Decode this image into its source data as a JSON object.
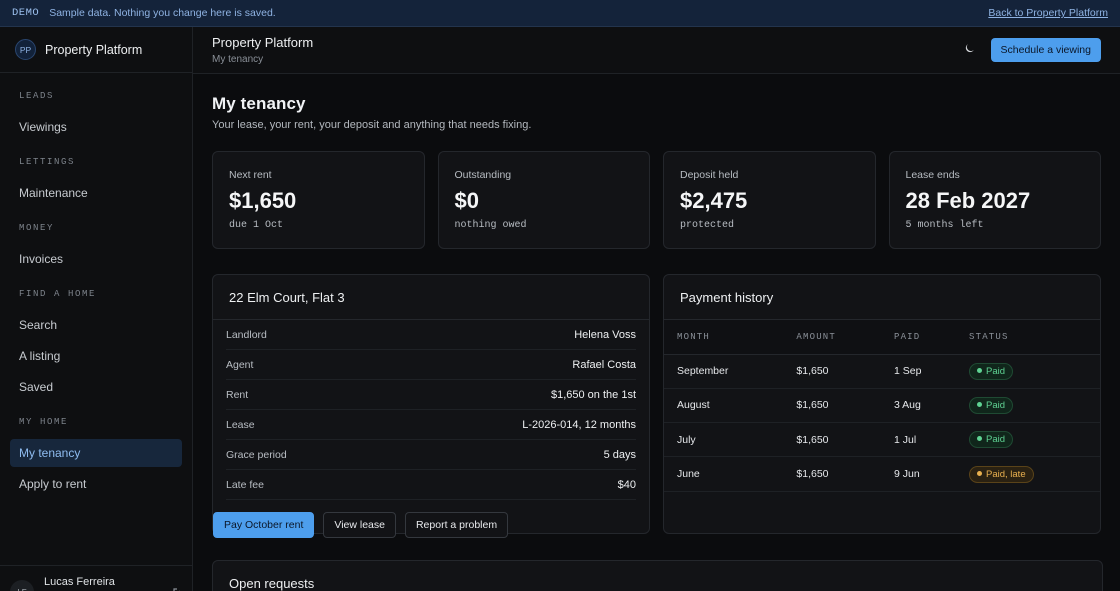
{
  "banner": {
    "tag": "DEMO",
    "text": "Sample data. Nothing you change here is saved.",
    "back_link": "Back to Property Platform"
  },
  "sidebar": {
    "logo_initials": "PP",
    "brand": "Property Platform",
    "sections": [
      {
        "title": "LEADS",
        "items": [
          "Viewings"
        ]
      },
      {
        "title": "LETTINGS",
        "items": [
          "Maintenance"
        ]
      },
      {
        "title": "MONEY",
        "items": [
          "Invoices"
        ]
      },
      {
        "title": "FIND A HOME",
        "items": [
          "Search",
          "A listing",
          "Saved"
        ]
      },
      {
        "title": "MY HOME",
        "items": [
          "My tenancy",
          "Apply to rent"
        ]
      }
    ],
    "active_item": "My tenancy",
    "user": {
      "initials": "LF",
      "name": "Lucas Ferreira"
    }
  },
  "header": {
    "title": "Property Platform",
    "subtitle": "My tenancy",
    "cta": "Schedule a viewing"
  },
  "page": {
    "title": "My tenancy",
    "subtitle": "Your lease, your rent, your deposit and anything that needs fixing."
  },
  "stats": [
    {
      "label": "Next rent",
      "value": "$1,650",
      "note": "due 1 Oct"
    },
    {
      "label": "Outstanding",
      "value": "$0",
      "note": "nothing owed"
    },
    {
      "label": "Deposit held",
      "value": "$2,475",
      "note": "protected"
    },
    {
      "label": "Lease ends",
      "value": "28 Feb 2027",
      "note": "5 months left"
    }
  ],
  "property": {
    "title": "22 Elm Court, Flat 3",
    "details": [
      {
        "k": "Landlord",
        "v": "Helena Voss"
      },
      {
        "k": "Agent",
        "v": "Rafael Costa"
      },
      {
        "k": "Rent",
        "v": "$1,650 on the 1st"
      },
      {
        "k": "Lease",
        "v": "L-2026-014, 12 months"
      },
      {
        "k": "Grace period",
        "v": "5 days"
      },
      {
        "k": "Late fee",
        "v": "$40"
      }
    ],
    "buttons": {
      "pay": "Pay October rent",
      "view": "View lease",
      "report": "Report a problem"
    }
  },
  "payments": {
    "title": "Payment history",
    "columns": [
      "MONTH",
      "AMOUNT",
      "PAID",
      "STATUS"
    ],
    "rows": [
      {
        "month": "September",
        "amount": "$1,650",
        "paid": "1 Sep",
        "status": "Paid",
        "late": false
      },
      {
        "month": "August",
        "amount": "$1,650",
        "paid": "3 Aug",
        "status": "Paid",
        "late": false
      },
      {
        "month": "July",
        "amount": "$1,650",
        "paid": "1 Jul",
        "status": "Paid",
        "late": false
      },
      {
        "month": "June",
        "amount": "$1,650",
        "paid": "9 Jun",
        "status": "Paid, late",
        "late": true
      }
    ]
  },
  "requests": {
    "title": "Open requests"
  },
  "icons": {
    "theme_toggle": "moon-icon",
    "logout": "logout-icon"
  }
}
